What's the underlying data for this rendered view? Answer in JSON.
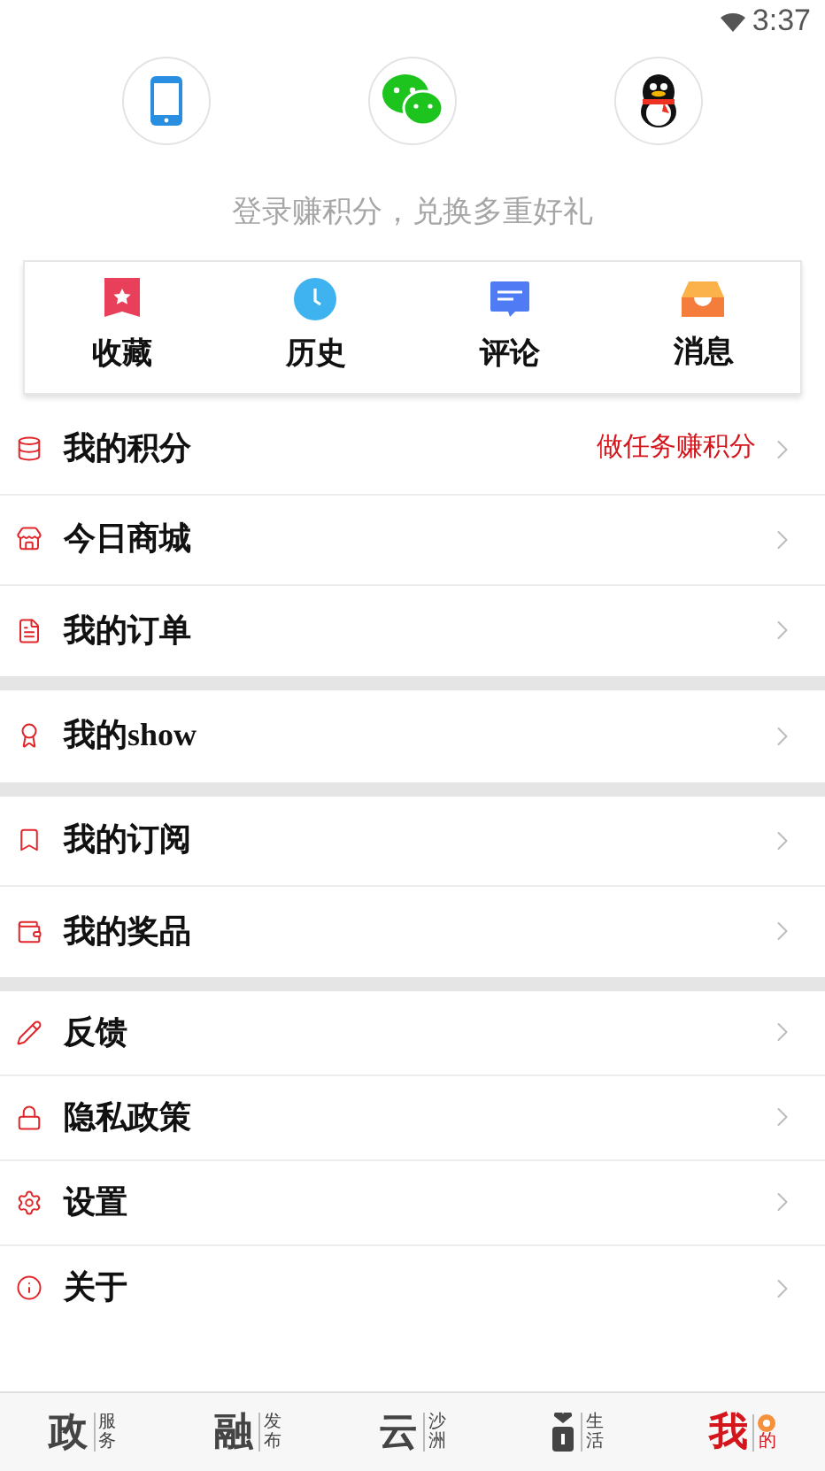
{
  "status_bar": {
    "time": "3:37"
  },
  "login": {
    "prompt": "登录赚积分，兑换多重好礼"
  },
  "shortcuts": [
    {
      "label": "收藏"
    },
    {
      "label": "历史"
    },
    {
      "label": "评论"
    },
    {
      "label": "消息"
    }
  ],
  "menu_groups": [
    [
      {
        "label": "我的积分",
        "hint": "做任务赚积分"
      },
      {
        "label": "今日商城"
      },
      {
        "label": "我的订单"
      }
    ],
    [
      {
        "label": "我的show"
      }
    ],
    [
      {
        "label": "我的订阅"
      },
      {
        "label": "我的奖品"
      }
    ],
    [
      {
        "label": "反馈"
      },
      {
        "label": "隐私政策"
      },
      {
        "label": "设置"
      },
      {
        "label": "关于"
      }
    ]
  ],
  "tab_bar": [
    {
      "kind": "text",
      "glyph": "政",
      "sub": "服务",
      "selected": false
    },
    {
      "kind": "text",
      "glyph": "融",
      "sub": "发布",
      "selected": false
    },
    {
      "kind": "text",
      "glyph": "云",
      "sub": "沙洲",
      "selected": false
    },
    {
      "kind": "icon",
      "sub": "生活",
      "selected": false
    },
    {
      "kind": "badged",
      "glyph": "我",
      "sub": "的",
      "selected": true
    }
  ]
}
